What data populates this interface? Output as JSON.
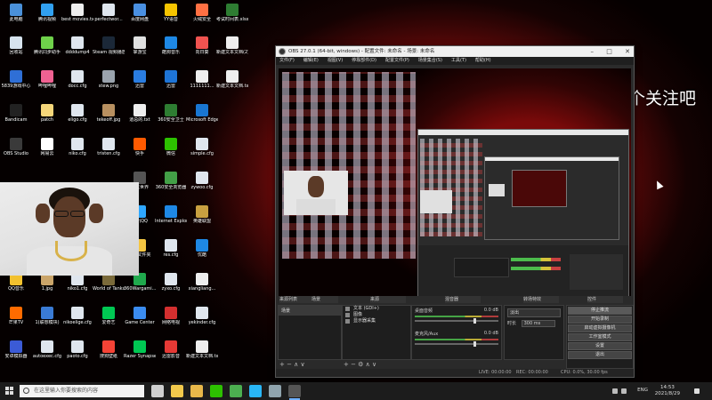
{
  "desktop_icons": [
    {
      "label": "此电脑",
      "color": "#4a90d9"
    },
    {
      "label": "回收站",
      "color": "#d7e3ee"
    },
    {
      "label": "5839游戏中心",
      "color": "#2f6fd6"
    },
    {
      "label": "Bandicam",
      "color": "#222"
    },
    {
      "label": "OBS Studio",
      "color": "#3a3a3a"
    },
    {
      "label": "QQ音乐",
      "color": "#f2c12e"
    },
    {
      "label": "芒果TV",
      "color": "#ff6b00"
    },
    {
      "label": "安卓模拟器",
      "color": "#3b5bd6"
    },
    {
      "label": "腾讯视频",
      "color": "#31a0f0"
    },
    {
      "label": "腾讯同步助手",
      "color": "#6fd14a"
    },
    {
      "label": "哔哩哔哩",
      "color": "#f06292"
    },
    {
      "label": "patch",
      "color": "#f5d67a"
    },
    {
      "label": "网易云",
      "color": "#ffffff"
    },
    {
      "label": "1.jpg",
      "color": "#caa56a"
    },
    {
      "label": "1(联想模块)",
      "color": "#3a7bd5"
    },
    {
      "label": "autoexec.cfg",
      "color": "#dfe6ee"
    },
    {
      "label": "best movies.txt",
      "color": "#eeeeee"
    },
    {
      "label": "ddddump4",
      "color": "#dfe6ee"
    },
    {
      "label": "docc.cfg",
      "color": "#dfe6ee"
    },
    {
      "label": "eligo.cfg",
      "color": "#dfe6ee"
    },
    {
      "label": "niko.cfg",
      "color": "#dfe6ee"
    },
    {
      "label": "niko1.cfg",
      "color": "#dfe6ee"
    },
    {
      "label": "nikoelige.cfg",
      "color": "#dfe6ee"
    },
    {
      "label": "paoto.cfg",
      "color": "#dfe6ee"
    },
    {
      "label": "perfectwor...",
      "color": "#dfe6ee"
    },
    {
      "label": "Steam 视频播放",
      "color": "#1b2838"
    },
    {
      "label": "stew.png",
      "color": "#9aa3ad"
    },
    {
      "label": "tekeoff.jpg",
      "color": "#b89060"
    },
    {
      "label": "tristen.cfg",
      "color": "#dfe6ee"
    },
    {
      "label": "World of Tanks ASIA",
      "color": "#7a6a3a"
    },
    {
      "label": "爱奇艺",
      "color": "#00c853"
    },
    {
      "label": "搜狗壁纸",
      "color": "#f44336"
    },
    {
      "label": "百度网盘",
      "color": "#4a90e2"
    },
    {
      "label": "掌游宝",
      "color": "#e0e0e0"
    },
    {
      "label": "迅雷",
      "color": "#2a7de1"
    },
    {
      "label": "道总的.txt",
      "color": "#eeeeee"
    },
    {
      "label": "快手",
      "color": "#ff5a00"
    },
    {
      "label": "坦克世界",
      "color": "#555555"
    },
    {
      "label": "腾讯QQ",
      "color": "#2ea7ff"
    },
    {
      "label": "腾讯文件夹",
      "color": "#f4c542"
    },
    {
      "label": "360Wargami...",
      "color": "#20a94d"
    },
    {
      "label": "Game Center",
      "color": "#3b8cf0"
    },
    {
      "label": "Razer Synapse",
      "color": "#00c853"
    },
    {
      "label": "YY语音",
      "color": "#f6c400"
    },
    {
      "label": "酷狗音乐",
      "color": "#1e88e5"
    },
    {
      "label": "迅雷",
      "color": "#1e74d6"
    },
    {
      "label": "360安全卫士",
      "color": "#2e7d32"
    },
    {
      "label": "微信",
      "color": "#2dc100"
    },
    {
      "label": "360安全浏览器",
      "color": "#43a047"
    },
    {
      "label": "Internet Explorer",
      "color": "#1e88e5"
    },
    {
      "label": "res.cfg",
      "color": "#dfe6ee"
    },
    {
      "label": "zyxo.cfg",
      "color": "#dfe6ee"
    },
    {
      "label": "网络电视",
      "color": "#d32f2f"
    },
    {
      "label": "迅雷影音",
      "color": "#e53935"
    },
    {
      "label": "火绒安全",
      "color": "#ff7043"
    },
    {
      "label": "向日葵",
      "color": "#ef5350"
    },
    {
      "label": "1111111...",
      "color": "#eeeeee"
    },
    {
      "label": "Microsoft Edge",
      "color": "#1976d2"
    },
    {
      "label": "simple.cfg",
      "color": "#dfe6ee"
    },
    {
      "label": "zywoo.cfg",
      "color": "#dfe6ee"
    },
    {
      "label": "英雄联盟",
      "color": "#c8a040"
    },
    {
      "label": "优酷",
      "color": "#1e88e5"
    },
    {
      "label": "xiangliang...",
      "color": "#eeeeee"
    },
    {
      "label": "yekinder.cfg",
      "color": "#dfe6ee"
    },
    {
      "label": "新建文本文档.txt",
      "color": "#eeeeee"
    },
    {
      "label": "考试时间表.xlsx",
      "color": "#2e7d32"
    },
    {
      "label": "新建文本文档(2).txt",
      "color": "#eeeeee"
    },
    {
      "label": "新建文本文档.txt",
      "color": "#eeeeee"
    }
  ],
  "obs": {
    "title": "OBS 27.0.1 (64-bit, windows) - 配置文件: 未命名 - 场景: 未命名",
    "menu": [
      "文件(F)",
      "编辑(E)",
      "视图(V)",
      "停靠部件(D)",
      "配置文件(P)",
      "场景集合(S)",
      "工具(T)",
      "帮助(H)"
    ],
    "dock_headers": [
      "来源列表",
      "场景",
      "来源",
      "混音器",
      "转场特效",
      "控件"
    ],
    "scene_item": "场景",
    "sources": [
      "文本 (GDI+)",
      "图像",
      "显示器采集"
    ],
    "mixer": [
      {
        "name": "桌面音频",
        "level": "0.0 dB"
      },
      {
        "name": "麦克风/Aux",
        "level": "0.0 dB"
      }
    ],
    "transition": {
      "type": "淡出",
      "duration_label": "时长",
      "duration": "300 ms"
    },
    "controls": [
      "停止推流",
      "开始录制",
      "启动虚拟摄像机",
      "工作室模式",
      "设置",
      "退出"
    ],
    "status": {
      "live": "LIVE: 00:00:00",
      "rec": "REC: 00:00:00",
      "cpu": "CPU: 0.0%, 30.00 fps"
    }
  },
  "overlay_text": "兄弟们点个关注吧",
  "taskbar": {
    "search_placeholder": "在这里输入你要搜索的内容",
    "lang": "ENG",
    "time": "14:53",
    "date": "2021/8/29",
    "apps": [
      {
        "name": "task-view",
        "color": "#cfcfcf"
      },
      {
        "name": "file-explorer",
        "color": "#f2c94c"
      },
      {
        "name": "folder",
        "color": "#e8b84a"
      },
      {
        "name": "wechat",
        "color": "#2dc100"
      },
      {
        "name": "chrome",
        "color": "#4caf50"
      },
      {
        "name": "qq",
        "color": "#29b6f6"
      },
      {
        "name": "explorer",
        "color": "#90a4ae"
      },
      {
        "name": "obs",
        "color": "#555555"
      }
    ]
  }
}
